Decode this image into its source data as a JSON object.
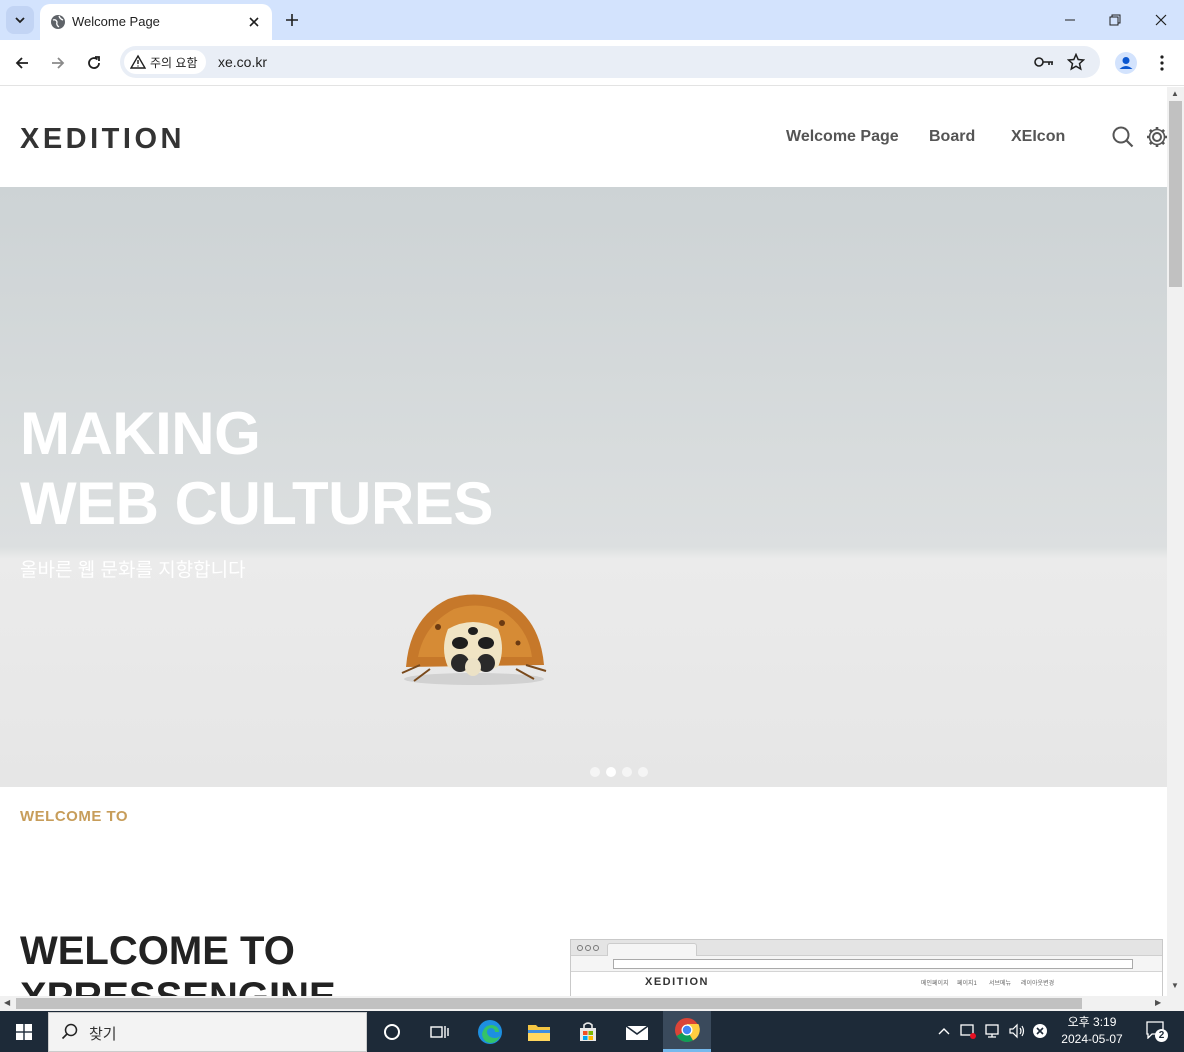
{
  "browser": {
    "tab_title": "Welcome Page",
    "security_label": "주의 요함",
    "url": "xe.co.kr"
  },
  "site": {
    "logo": "XEDITION",
    "nav": [
      "Welcome Page",
      "Board",
      "XEIcon"
    ]
  },
  "hero": {
    "line1": "MAKING",
    "line2": "WEB CULTURES",
    "subtitle": "올바른 웹 문화를 지향합니다",
    "slide_count": 4,
    "active_slide": 2
  },
  "welcome": {
    "eyebrow": "WELCOME TO",
    "title_line1": "WELCOME TO",
    "title_line2": "XPRESSENGINE"
  },
  "mockup": {
    "logo": "XEDITION",
    "nav": [
      "메인페이지",
      "페이지1",
      "서브메뉴",
      "레이아웃변경"
    ]
  },
  "taskbar": {
    "search_placeholder": "찾기",
    "time": "오후 3:19",
    "date": "2024-05-07",
    "notification_count": "2"
  }
}
